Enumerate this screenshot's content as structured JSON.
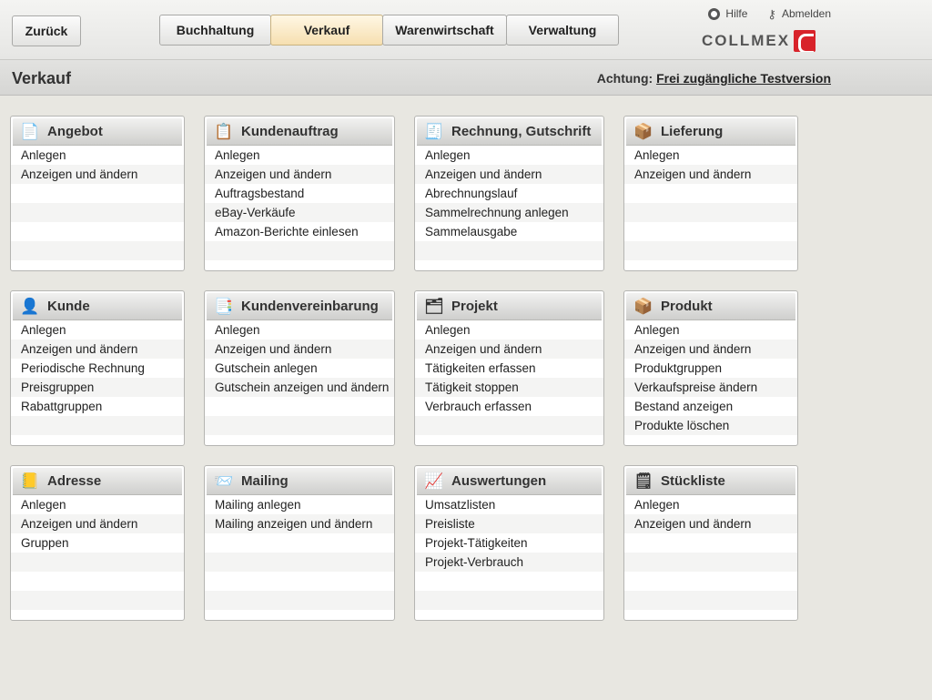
{
  "header": {
    "back_label": "Zurück",
    "tabs": [
      {
        "label": "Buchhaltung"
      },
      {
        "label": "Verkauf"
      },
      {
        "label": "Warenwirtschaft"
      },
      {
        "label": "Verwaltung"
      }
    ],
    "help_label": "Hilfe",
    "logout_label": "Abmelden",
    "logo_text": "COLLMEX"
  },
  "section": {
    "title": "Verkauf",
    "notice_prefix": "Achtung:",
    "notice_link": "Frei zugängliche Testversion"
  },
  "cards": [
    {
      "title": "Angebot",
      "icon": "document-icon",
      "items": [
        "Anlegen",
        "Anzeigen und ändern"
      ]
    },
    {
      "title": "Kundenauftrag",
      "icon": "clipboard-icon",
      "items": [
        "Anlegen",
        "Anzeigen und ändern",
        "Auftragsbestand",
        "eBay-Verkäufe",
        "Amazon-Berichte einlesen"
      ]
    },
    {
      "title": "Rechnung, Gutschrift",
      "icon": "invoice-coins-icon",
      "items": [
        "Anlegen",
        "Anzeigen und ändern",
        "Abrechnungslauf",
        "Sammelrechnung anlegen",
        "Sammelausgabe"
      ]
    },
    {
      "title": "Lieferung",
      "icon": "package-delivery-icon",
      "items": [
        "Anlegen",
        "Anzeigen und ändern"
      ]
    },
    {
      "title": "Kunde",
      "icon": "person-icon",
      "items": [
        "Anlegen",
        "Anzeigen und ändern",
        "Periodische Rechnung",
        "Preisgruppen",
        "Rabattgruppen"
      ]
    },
    {
      "title": "Kundenvereinbarung",
      "icon": "agreement-icon",
      "items": [
        "Anlegen",
        "Anzeigen und ändern",
        "Gutschein anlegen",
        "Gutschein anzeigen und ändern"
      ]
    },
    {
      "title": "Projekt",
      "icon": "project-tree-icon",
      "items": [
        "Anlegen",
        "Anzeigen und ändern",
        "Tätigkeiten erfassen",
        "Tätigkeit stoppen",
        "Verbrauch erfassen"
      ]
    },
    {
      "title": "Produkt",
      "icon": "box-icon",
      "items": [
        "Anlegen",
        "Anzeigen und ändern",
        "Produktgruppen",
        "Verkaufspreise ändern",
        "Bestand anzeigen",
        "Produkte löschen"
      ]
    },
    {
      "title": "Adresse",
      "icon": "address-book-icon",
      "items": [
        "Anlegen",
        "Anzeigen und ändern",
        "Gruppen"
      ]
    },
    {
      "title": "Mailing",
      "icon": "mailing-icon",
      "items": [
        "Mailing anlegen",
        "Mailing anzeigen und ändern"
      ]
    },
    {
      "title": "Auswertungen",
      "icon": "report-chart-icon",
      "items": [
        "Umsatzlisten",
        "Preisliste",
        "Projekt-Tätigkeiten",
        "Projekt-Verbrauch"
      ]
    },
    {
      "title": "Stückliste",
      "icon": "parts-list-icon",
      "items": [
        "Anlegen",
        "Anzeigen und ändern"
      ]
    }
  ],
  "colors": {
    "active_tab": "#f6dfb0",
    "background": "#e8e7e1",
    "logo_red": "#d8232a"
  }
}
